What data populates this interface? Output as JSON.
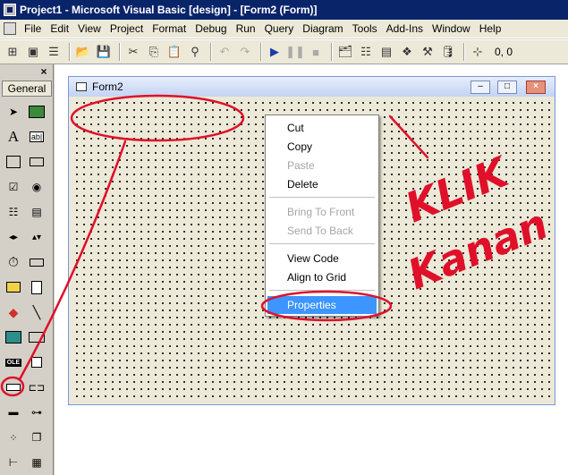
{
  "window": {
    "title": "Project1 - Microsoft Visual Basic [design] - [Form2 (Form)]"
  },
  "menubar": [
    "File",
    "Edit",
    "View",
    "Project",
    "Format",
    "Debug",
    "Run",
    "Query",
    "Diagram",
    "Tools",
    "Add-Ins",
    "Window",
    "Help"
  ],
  "toolbar": {
    "coords": "0, 0"
  },
  "toolbox": {
    "close": "×",
    "tab": "General",
    "tools": [
      "pointer",
      "picturebox",
      "label",
      "textbox",
      "frame",
      "commandbutton",
      "checkbox",
      "optionbutton",
      "combobox",
      "listbox",
      "hscrollbar",
      "vscrollbar",
      "timer",
      "drivelistbox",
      "dirlistbox",
      "filelistbox",
      "shape",
      "line",
      "image",
      "data",
      "ole",
      "extra1",
      "extra2",
      "extra3",
      "extra4",
      "extra5",
      "extra6",
      "extra7",
      "extra8",
      "extra9"
    ]
  },
  "form": {
    "caption": "Form2",
    "minimize": "–",
    "restore": "□",
    "close": "×"
  },
  "context_menu": {
    "items": [
      {
        "label": "Cut",
        "enabled": true
      },
      {
        "label": "Copy",
        "enabled": true
      },
      {
        "label": "Paste",
        "enabled": false
      },
      {
        "label": "Delete",
        "enabled": true
      },
      {
        "label": "Bring To Front",
        "enabled": false
      },
      {
        "label": "Send To Back",
        "enabled": false
      },
      {
        "label": "View Code",
        "enabled": true
      },
      {
        "label": "Align to Grid",
        "enabled": true
      },
      {
        "label": "Properties",
        "enabled": true,
        "selected": true
      }
    ]
  },
  "annotation": {
    "handwriting_line1": "KLIK",
    "handwriting_line2": "Kanan",
    "color": "#e0102a"
  }
}
